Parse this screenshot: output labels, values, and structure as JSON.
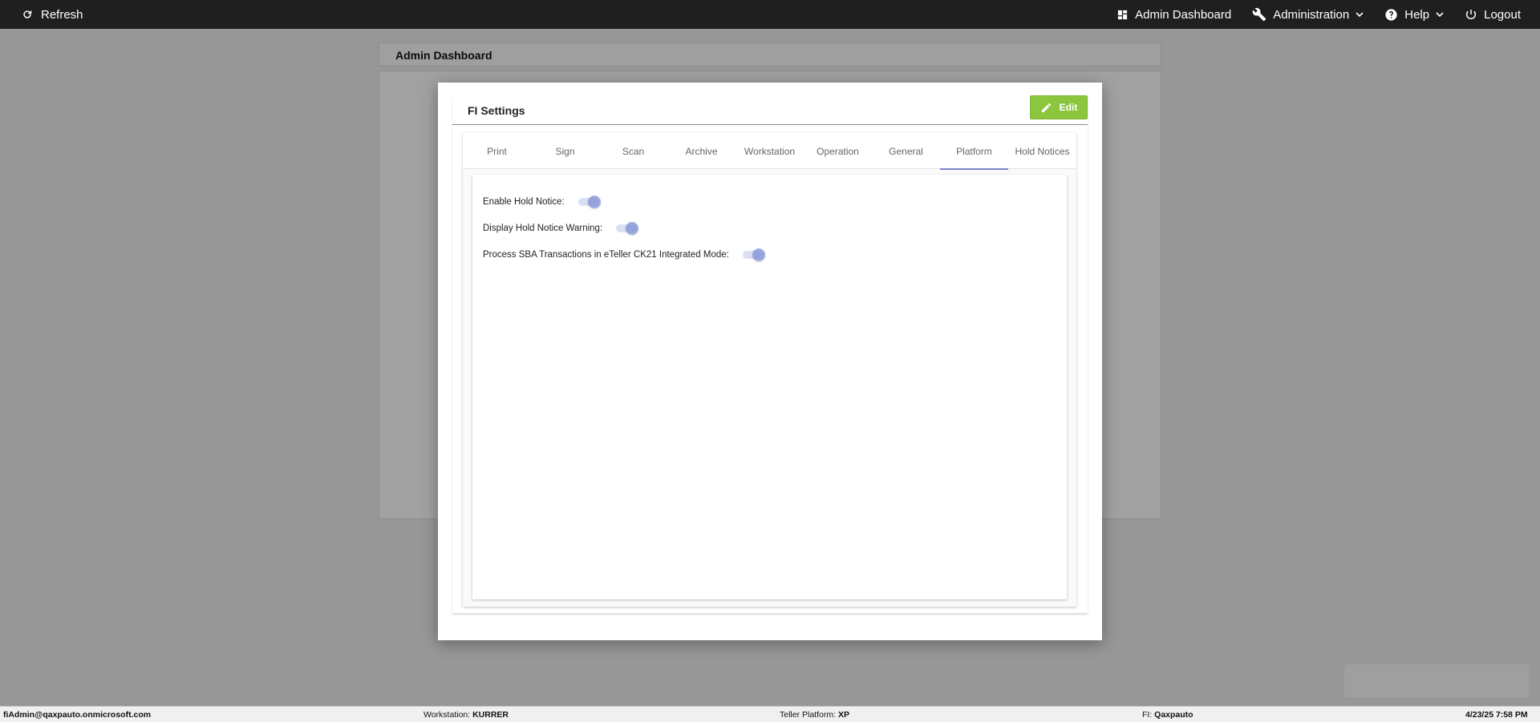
{
  "topbar": {
    "refresh_label": "Refresh",
    "admin_dashboard_label": "Admin Dashboard",
    "administration_label": "Administration",
    "help_label": "Help",
    "logout_label": "Logout"
  },
  "background": {
    "header_title": "Admin Dashboard"
  },
  "modal": {
    "title": "FI Settings",
    "edit_label": "Edit",
    "tabs": [
      {
        "label": "Print"
      },
      {
        "label": "Sign"
      },
      {
        "label": "Scan"
      },
      {
        "label": "Archive"
      },
      {
        "label": "Workstation"
      },
      {
        "label": "Operation"
      },
      {
        "label": "General"
      },
      {
        "label": "Platform",
        "active": true
      },
      {
        "label": "Hold Notices"
      }
    ],
    "settings": [
      {
        "label": "Enable Hold Notice:",
        "enabled": true
      },
      {
        "label": "Display Hold Notice Warning:",
        "enabled": true
      },
      {
        "label": "Process SBA Transactions in eTeller CK21 Integrated Mode:",
        "enabled": true
      }
    ]
  },
  "statusbar": {
    "user": "fiAdmin@qaxpauto.onmicrosoft.com",
    "workstation_label": "Workstation:",
    "workstation_value": "KURRER",
    "platform_label": "Teller Platform:",
    "platform_value": "XP",
    "fi_label": "FI:",
    "fi_value": "Qaxpauto",
    "datetime": "4/23/25 7:58 PM"
  },
  "colors": {
    "topbar_bg": "#1f1f1f",
    "edit_button": "#8cc63f",
    "active_tab_underline": "#7986cb",
    "toggle_on": "#7e8fd6"
  }
}
